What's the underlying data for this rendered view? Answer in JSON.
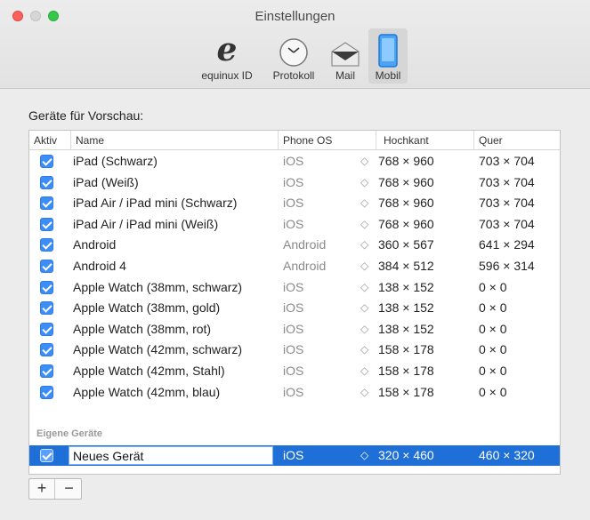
{
  "window": {
    "title": "Einstellungen"
  },
  "toolbar": {
    "items": [
      {
        "label": "equinux ID",
        "icon": "equinux-e-icon"
      },
      {
        "label": "Protokoll",
        "icon": "clock-icon"
      },
      {
        "label": "Mail",
        "icon": "envelope-icon"
      },
      {
        "label": "Mobil",
        "icon": "mobile-device-icon",
        "selected": true
      }
    ]
  },
  "section": {
    "title": "Geräte für Vorschau:"
  },
  "table": {
    "headers": {
      "aktiv": "Aktiv",
      "name": "Name",
      "os": "Phone OS",
      "hochkant": "Hochkant",
      "quer": "Quer"
    },
    "rows": [
      {
        "name": "iPad (Schwarz)",
        "os": "iOS",
        "hochkant": "768 × 960",
        "quer": "703 × 704",
        "checked": true
      },
      {
        "name": "iPad (Weiß)",
        "os": "iOS",
        "hochkant": "768 × 960",
        "quer": "703 × 704",
        "checked": true
      },
      {
        "name": "iPad Air / iPad mini (Schwarz)",
        "os": "iOS",
        "hochkant": "768 × 960",
        "quer": "703 × 704",
        "checked": true
      },
      {
        "name": "iPad Air / iPad mini (Weiß)",
        "os": "iOS",
        "hochkant": "768 × 960",
        "quer": "703 × 704",
        "checked": true
      },
      {
        "name": "Android",
        "os": "Android",
        "hochkant": "360 × 567",
        "quer": "641 × 294",
        "checked": true
      },
      {
        "name": "Android 4",
        "os": "Android",
        "hochkant": "384 × 512",
        "quer": "596 × 314",
        "checked": true
      },
      {
        "name": "Apple Watch (38mm, schwarz)",
        "os": "iOS",
        "hochkant": "138 × 152",
        "quer": "0 × 0",
        "checked": true
      },
      {
        "name": "Apple Watch (38mm, gold)",
        "os": "iOS",
        "hochkant": "138 × 152",
        "quer": "0 × 0",
        "checked": true
      },
      {
        "name": "Apple Watch (38mm, rot)",
        "os": "iOS",
        "hochkant": "138 × 152",
        "quer": "0 × 0",
        "checked": true
      },
      {
        "name": "Apple Watch (42mm, schwarz)",
        "os": "iOS",
        "hochkant": "158 × 178",
        "quer": "0 × 0",
        "checked": true
      },
      {
        "name": "Apple Watch (42mm, Stahl)",
        "os": "iOS",
        "hochkant": "158 × 178",
        "quer": "0 × 0",
        "checked": true
      },
      {
        "name": "Apple Watch (42mm, blau)",
        "os": "iOS",
        "hochkant": "158 × 178",
        "quer": "0 × 0",
        "checked": true
      }
    ],
    "group_label": "Eigene Geräte",
    "custom_row": {
      "name": "Neues Gerät",
      "os": "iOS",
      "hochkant": "320 × 460",
      "quer": "460 × 320",
      "checked": true
    },
    "stepper_glyph": "◇"
  },
  "buttons": {
    "add": "+",
    "remove": "−"
  },
  "colors": {
    "accent": "#1f6fd9",
    "checkbox": "#3b8df7"
  }
}
